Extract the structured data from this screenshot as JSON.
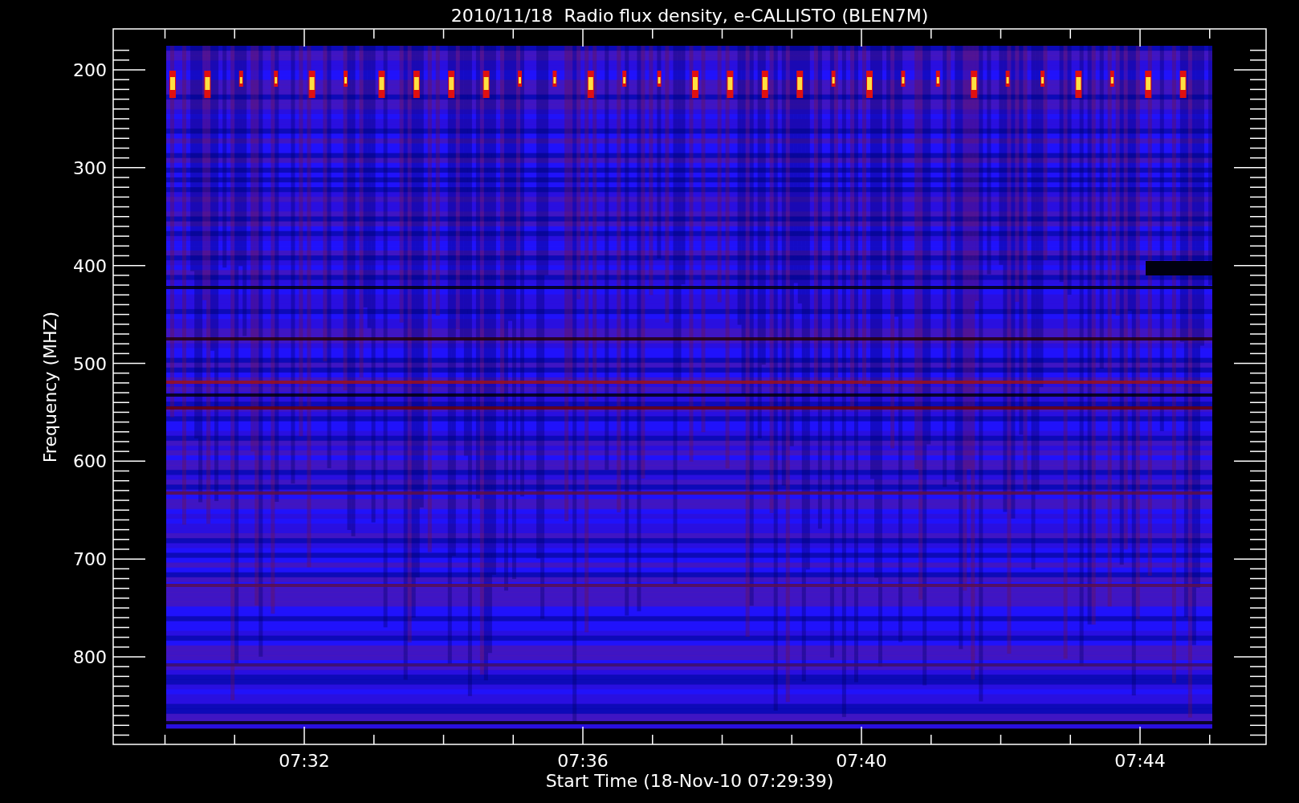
{
  "title": "2010/11/18  Radio flux density, e-CALLISTO (BLEN7M)",
  "ylabel": "Frequency (MHZ)",
  "xlabel": "Start Time (18-Nov-10 07:29:39)",
  "yticks": [
    "200",
    "300",
    "400",
    "500",
    "600",
    "700",
    "800"
  ],
  "xticks": [
    "07:32",
    "07:36",
    "07:40",
    "07:44"
  ]
}
